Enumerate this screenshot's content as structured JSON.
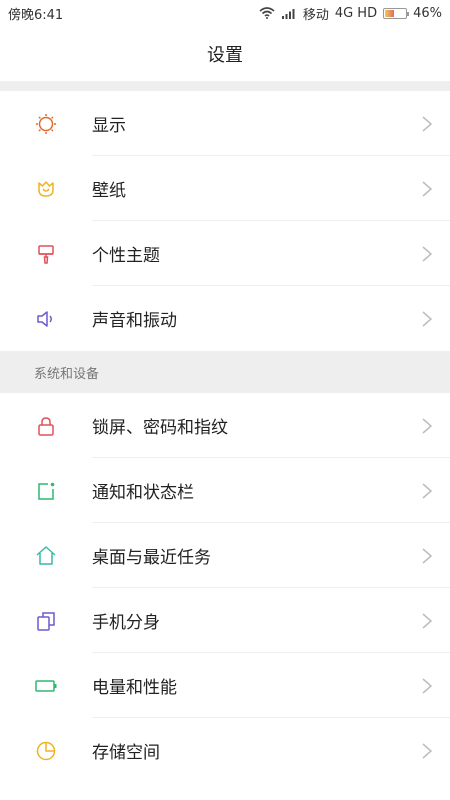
{
  "status": {
    "time": "傍晚6:41",
    "carrier": "移动",
    "network": "4G HD",
    "battery": "46%",
    "battery_level": 0.46
  },
  "header": {
    "title": "设置"
  },
  "groups": [
    {
      "items": [
        {
          "label": "显示",
          "icon": "sun-icon",
          "color": "#e06a2c"
        },
        {
          "label": "壁纸",
          "icon": "flower-icon",
          "color": "#f0b323"
        },
        {
          "label": "个性主题",
          "icon": "brush-icon",
          "color": "#e0505a"
        },
        {
          "label": "声音和振动",
          "icon": "speaker-icon",
          "color": "#6a5acd"
        }
      ]
    },
    {
      "header": "系统和设备",
      "items": [
        {
          "label": "锁屏、密码和指纹",
          "icon": "lock-icon",
          "color": "#e0505a"
        },
        {
          "label": "通知和状态栏",
          "icon": "notification-icon",
          "color": "#2eb872"
        },
        {
          "label": "桌面与最近任务",
          "icon": "home-icon",
          "color": "#3cb9a6"
        },
        {
          "label": "手机分身",
          "icon": "dual-icon",
          "color": "#6a5acd"
        },
        {
          "label": "电量和性能",
          "icon": "battery-icon",
          "color": "#2eb872"
        },
        {
          "label": "存储空间",
          "icon": "pie-chart-icon",
          "color": "#f0b323"
        }
      ]
    }
  ]
}
